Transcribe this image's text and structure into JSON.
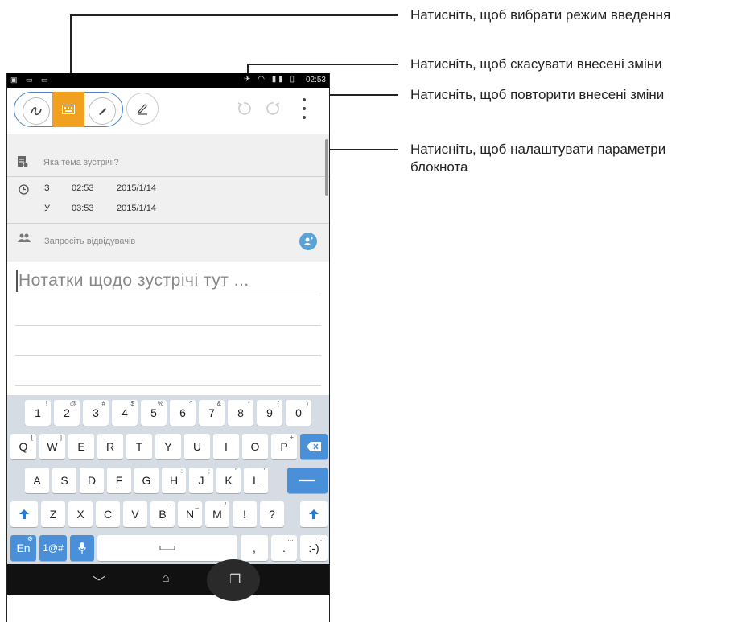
{
  "callouts": {
    "input_mode": "Натисніть, щоб вибрати режим введення",
    "undo": "Натисніть, щоб скасувати внесені зміни",
    "redo": "Натисніть, щоб повторити внесені зміни",
    "settings_line1": "Натисніть, щоб налаштувати параметри",
    "settings_line2": "блокнота"
  },
  "status_bar": {
    "time": "02:53"
  },
  "form": {
    "topic_placeholder": "Яка тема зустрічі?",
    "from_label": "З",
    "from_time": "02:53",
    "from_date": "2015/1/14",
    "to_label": "У",
    "to_time": "03:53",
    "to_date": "2015/1/14",
    "attendees_placeholder": "Запросіть відвідувачів"
  },
  "notes": {
    "placeholder": "Нотатки щодо зустрічі тут ..."
  },
  "keyboard": {
    "row1": [
      [
        "1",
        "!"
      ],
      [
        "2",
        "@"
      ],
      [
        "3",
        "#"
      ],
      [
        "4",
        "$"
      ],
      [
        "5",
        "%"
      ],
      [
        "6",
        "^"
      ],
      [
        "7",
        "&"
      ],
      [
        "8",
        "*"
      ],
      [
        "9",
        "("
      ],
      [
        "0",
        ")"
      ]
    ],
    "row2": [
      [
        "Q",
        "["
      ],
      [
        "W",
        "]"
      ],
      [
        "E",
        ""
      ],
      [
        "R",
        ""
      ],
      [
        "T",
        ""
      ],
      [
        "Y",
        ""
      ],
      [
        "U",
        ""
      ],
      [
        "I",
        ""
      ],
      [
        "O",
        ""
      ],
      [
        "P",
        "+"
      ]
    ],
    "row3": [
      [
        "A",
        ""
      ],
      [
        "S",
        ""
      ],
      [
        "D",
        ""
      ],
      [
        "F",
        ""
      ],
      [
        "G",
        ""
      ],
      [
        "H",
        ":"
      ],
      [
        "J",
        ";"
      ],
      [
        "K",
        "\""
      ],
      [
        "L",
        "'"
      ]
    ],
    "row4": [
      [
        "Z",
        ""
      ],
      [
        "X",
        ""
      ],
      [
        "C",
        ""
      ],
      [
        "V",
        ""
      ],
      [
        "B",
        "-"
      ],
      [
        "N",
        "_"
      ],
      [
        "M",
        "/"
      ],
      [
        "!",
        ""
      ],
      [
        "?",
        ""
      ]
    ],
    "lang_key": "En",
    "symbols_key": "1@#",
    "comma": ",",
    "period": ".",
    "smiley": ":-)"
  },
  "colors": {
    "accent": "#f1a11f",
    "keyboard_blue": "#4a90d9",
    "mode_outline": "#4a86c8"
  },
  "icons": [
    "handwriting-icon",
    "keyboard-icon",
    "brush-icon",
    "pen-settings-icon",
    "undo-icon",
    "redo-icon",
    "more-icon",
    "notepad-icon",
    "clock-icon",
    "people-icon",
    "add-person-icon",
    "backspace-icon",
    "enter-icon",
    "shift-icon",
    "mic-icon",
    "back-icon",
    "home-icon",
    "recent-apps-icon"
  ]
}
